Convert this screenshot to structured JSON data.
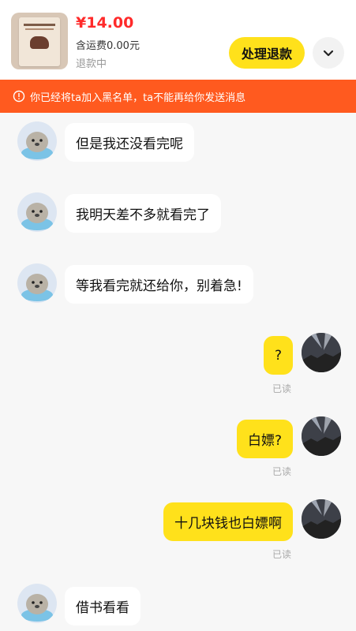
{
  "order": {
    "price": "¥14.00",
    "shipping": "含运费0.00元",
    "status": "退款中",
    "refund_button": "处理退款"
  },
  "banner": {
    "text": "你已经将ta加入黑名单，ta不能再给你发送消息"
  },
  "messages": [
    {
      "side": "left",
      "text": "但是我还没看完呢"
    },
    {
      "side": "left",
      "text": "我明天差不多就看完了"
    },
    {
      "side": "left",
      "text": "等我看完就还给你，别着急!"
    },
    {
      "side": "right",
      "text": "?",
      "receipt": "已读"
    },
    {
      "side": "right",
      "text": "白嫖?",
      "receipt": "已读"
    },
    {
      "side": "right",
      "text": "十几块钱也白嫖啊",
      "receipt": "已读"
    },
    {
      "side": "left",
      "text": "借书看看"
    }
  ],
  "colors": {
    "price": "#ff2a2a",
    "accent_yellow": "#ffe11b",
    "banner": "#ff5a1f"
  }
}
